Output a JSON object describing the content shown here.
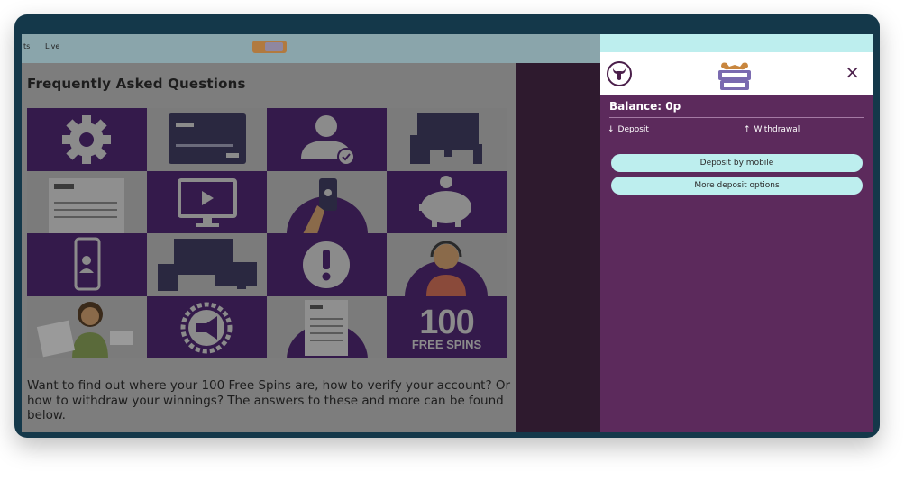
{
  "nav": {
    "item_1": "ts",
    "item_2": "Live"
  },
  "faq": {
    "title": "Frequently Asked Questions",
    "intro": "Want to find out where your 100 Free Spins are, how to verify your account? Or how to withdraw your winnings? The answers to these and more can be found below.",
    "tiles": [
      "gear-icon",
      "bank-card",
      "user-verified-icon",
      "phone-casino-devices",
      "bank-statement",
      "video-play-icon",
      "phone-hand",
      "piggy-bank-icon",
      "mobile-user-icon",
      "phone-casino-devices",
      "alert-icon",
      "support-agent",
      "woman-documents",
      "megaphone-icon",
      "statement-document",
      "100-free-spins"
    ],
    "free_spins": {
      "number": "100",
      "label": "FREE SPINS"
    }
  },
  "drawer": {
    "balance": "Balance: 0p",
    "deposit_tab": "Deposit",
    "withdrawal_tab": "Withdrawal",
    "deposit_mobile": "Deposit by mobile",
    "more_options": "More deposit options",
    "close": "×",
    "brand": "VEGAS MOOSE"
  },
  "colors": {
    "drawer_bg": "#5c2a5c",
    "accent": "#bdeeee",
    "tile_purple": "#341a4b"
  }
}
